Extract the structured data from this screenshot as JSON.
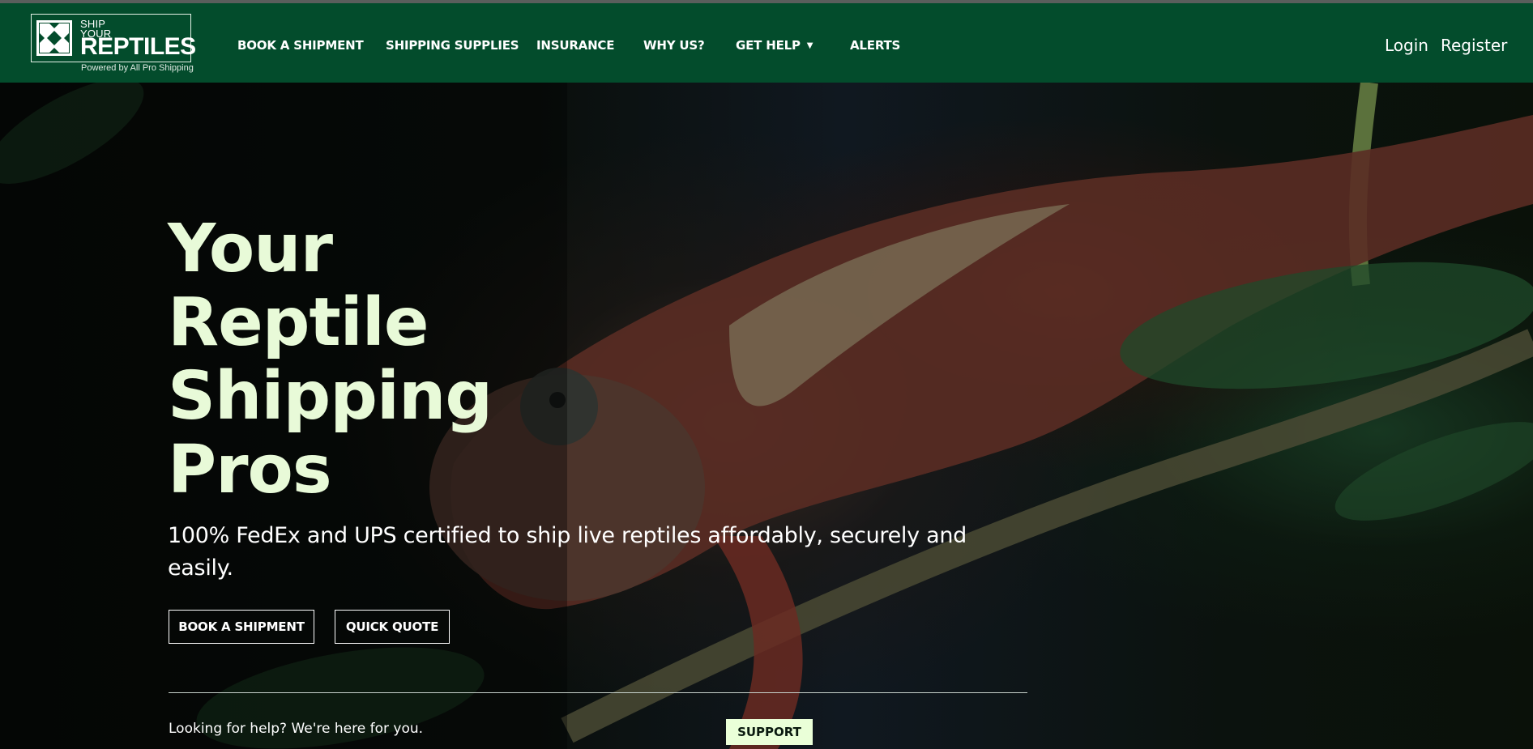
{
  "logo": {
    "line1": "SHIP",
    "line2": "YOUR",
    "line3": "REPTILES",
    "powered": "Powered by All Pro Shipping",
    "icon": "crate-x-icon"
  },
  "nav": {
    "items": [
      {
        "label": "BOOK A SHIPMENT"
      },
      {
        "label": "SHIPPING SUPPLIES"
      },
      {
        "label": "INSURANCE"
      },
      {
        "label": "WHY US?"
      },
      {
        "label": "GET HELP",
        "icon": "chevron-down-icon"
      },
      {
        "label": "ALERTS"
      }
    ],
    "login": "Login",
    "register": "Register"
  },
  "hero": {
    "title_lines": [
      "Your",
      "Reptile",
      "Shipping",
      "Pros"
    ],
    "subtitle": "100% FedEx and UPS certified to ship live reptiles affordably, securely and easily.",
    "buttons": {
      "book": "BOOK A SHIPMENT",
      "quote": "QUICK QUOTE"
    },
    "help_text": "Looking for help? We're here for you.",
    "support": "SUPPORT"
  },
  "colors": {
    "nav_bg": "#034c2c",
    "hero_title": "#e8fad8",
    "support_bg": "#eaffd8"
  }
}
